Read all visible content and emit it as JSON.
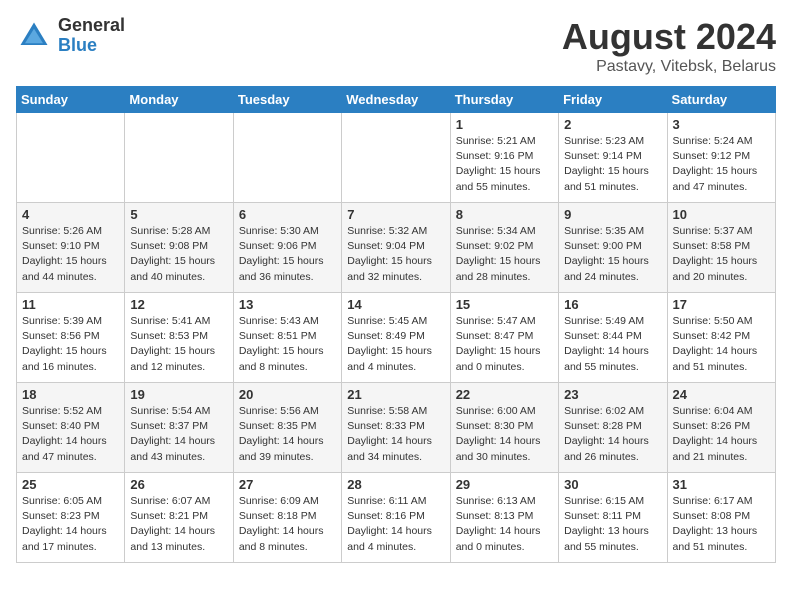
{
  "logo": {
    "general": "General",
    "blue": "Blue"
  },
  "title": "August 2024",
  "subtitle": "Pastavy, Vitebsk, Belarus",
  "headers": [
    "Sunday",
    "Monday",
    "Tuesday",
    "Wednesday",
    "Thursday",
    "Friday",
    "Saturday"
  ],
  "weeks": [
    [
      {
        "day": "",
        "info": ""
      },
      {
        "day": "",
        "info": ""
      },
      {
        "day": "",
        "info": ""
      },
      {
        "day": "",
        "info": ""
      },
      {
        "day": "1",
        "info": "Sunrise: 5:21 AM\nSunset: 9:16 PM\nDaylight: 15 hours\nand 55 minutes."
      },
      {
        "day": "2",
        "info": "Sunrise: 5:23 AM\nSunset: 9:14 PM\nDaylight: 15 hours\nand 51 minutes."
      },
      {
        "day": "3",
        "info": "Sunrise: 5:24 AM\nSunset: 9:12 PM\nDaylight: 15 hours\nand 47 minutes."
      }
    ],
    [
      {
        "day": "4",
        "info": "Sunrise: 5:26 AM\nSunset: 9:10 PM\nDaylight: 15 hours\nand 44 minutes."
      },
      {
        "day": "5",
        "info": "Sunrise: 5:28 AM\nSunset: 9:08 PM\nDaylight: 15 hours\nand 40 minutes."
      },
      {
        "day": "6",
        "info": "Sunrise: 5:30 AM\nSunset: 9:06 PM\nDaylight: 15 hours\nand 36 minutes."
      },
      {
        "day": "7",
        "info": "Sunrise: 5:32 AM\nSunset: 9:04 PM\nDaylight: 15 hours\nand 32 minutes."
      },
      {
        "day": "8",
        "info": "Sunrise: 5:34 AM\nSunset: 9:02 PM\nDaylight: 15 hours\nand 28 minutes."
      },
      {
        "day": "9",
        "info": "Sunrise: 5:35 AM\nSunset: 9:00 PM\nDaylight: 15 hours\nand 24 minutes."
      },
      {
        "day": "10",
        "info": "Sunrise: 5:37 AM\nSunset: 8:58 PM\nDaylight: 15 hours\nand 20 minutes."
      }
    ],
    [
      {
        "day": "11",
        "info": "Sunrise: 5:39 AM\nSunset: 8:56 PM\nDaylight: 15 hours\nand 16 minutes."
      },
      {
        "day": "12",
        "info": "Sunrise: 5:41 AM\nSunset: 8:53 PM\nDaylight: 15 hours\nand 12 minutes."
      },
      {
        "day": "13",
        "info": "Sunrise: 5:43 AM\nSunset: 8:51 PM\nDaylight: 15 hours\nand 8 minutes."
      },
      {
        "day": "14",
        "info": "Sunrise: 5:45 AM\nSunset: 8:49 PM\nDaylight: 15 hours\nand 4 minutes."
      },
      {
        "day": "15",
        "info": "Sunrise: 5:47 AM\nSunset: 8:47 PM\nDaylight: 15 hours\nand 0 minutes."
      },
      {
        "day": "16",
        "info": "Sunrise: 5:49 AM\nSunset: 8:44 PM\nDaylight: 14 hours\nand 55 minutes."
      },
      {
        "day": "17",
        "info": "Sunrise: 5:50 AM\nSunset: 8:42 PM\nDaylight: 14 hours\nand 51 minutes."
      }
    ],
    [
      {
        "day": "18",
        "info": "Sunrise: 5:52 AM\nSunset: 8:40 PM\nDaylight: 14 hours\nand 47 minutes."
      },
      {
        "day": "19",
        "info": "Sunrise: 5:54 AM\nSunset: 8:37 PM\nDaylight: 14 hours\nand 43 minutes."
      },
      {
        "day": "20",
        "info": "Sunrise: 5:56 AM\nSunset: 8:35 PM\nDaylight: 14 hours\nand 39 minutes."
      },
      {
        "day": "21",
        "info": "Sunrise: 5:58 AM\nSunset: 8:33 PM\nDaylight: 14 hours\nand 34 minutes."
      },
      {
        "day": "22",
        "info": "Sunrise: 6:00 AM\nSunset: 8:30 PM\nDaylight: 14 hours\nand 30 minutes."
      },
      {
        "day": "23",
        "info": "Sunrise: 6:02 AM\nSunset: 8:28 PM\nDaylight: 14 hours\nand 26 minutes."
      },
      {
        "day": "24",
        "info": "Sunrise: 6:04 AM\nSunset: 8:26 PM\nDaylight: 14 hours\nand 21 minutes."
      }
    ],
    [
      {
        "day": "25",
        "info": "Sunrise: 6:05 AM\nSunset: 8:23 PM\nDaylight: 14 hours\nand 17 minutes."
      },
      {
        "day": "26",
        "info": "Sunrise: 6:07 AM\nSunset: 8:21 PM\nDaylight: 14 hours\nand 13 minutes."
      },
      {
        "day": "27",
        "info": "Sunrise: 6:09 AM\nSunset: 8:18 PM\nDaylight: 14 hours\nand 8 minutes."
      },
      {
        "day": "28",
        "info": "Sunrise: 6:11 AM\nSunset: 8:16 PM\nDaylight: 14 hours\nand 4 minutes."
      },
      {
        "day": "29",
        "info": "Sunrise: 6:13 AM\nSunset: 8:13 PM\nDaylight: 14 hours\nand 0 minutes."
      },
      {
        "day": "30",
        "info": "Sunrise: 6:15 AM\nSunset: 8:11 PM\nDaylight: 13 hours\nand 55 minutes."
      },
      {
        "day": "31",
        "info": "Sunrise: 6:17 AM\nSunset: 8:08 PM\nDaylight: 13 hours\nand 51 minutes."
      }
    ]
  ]
}
